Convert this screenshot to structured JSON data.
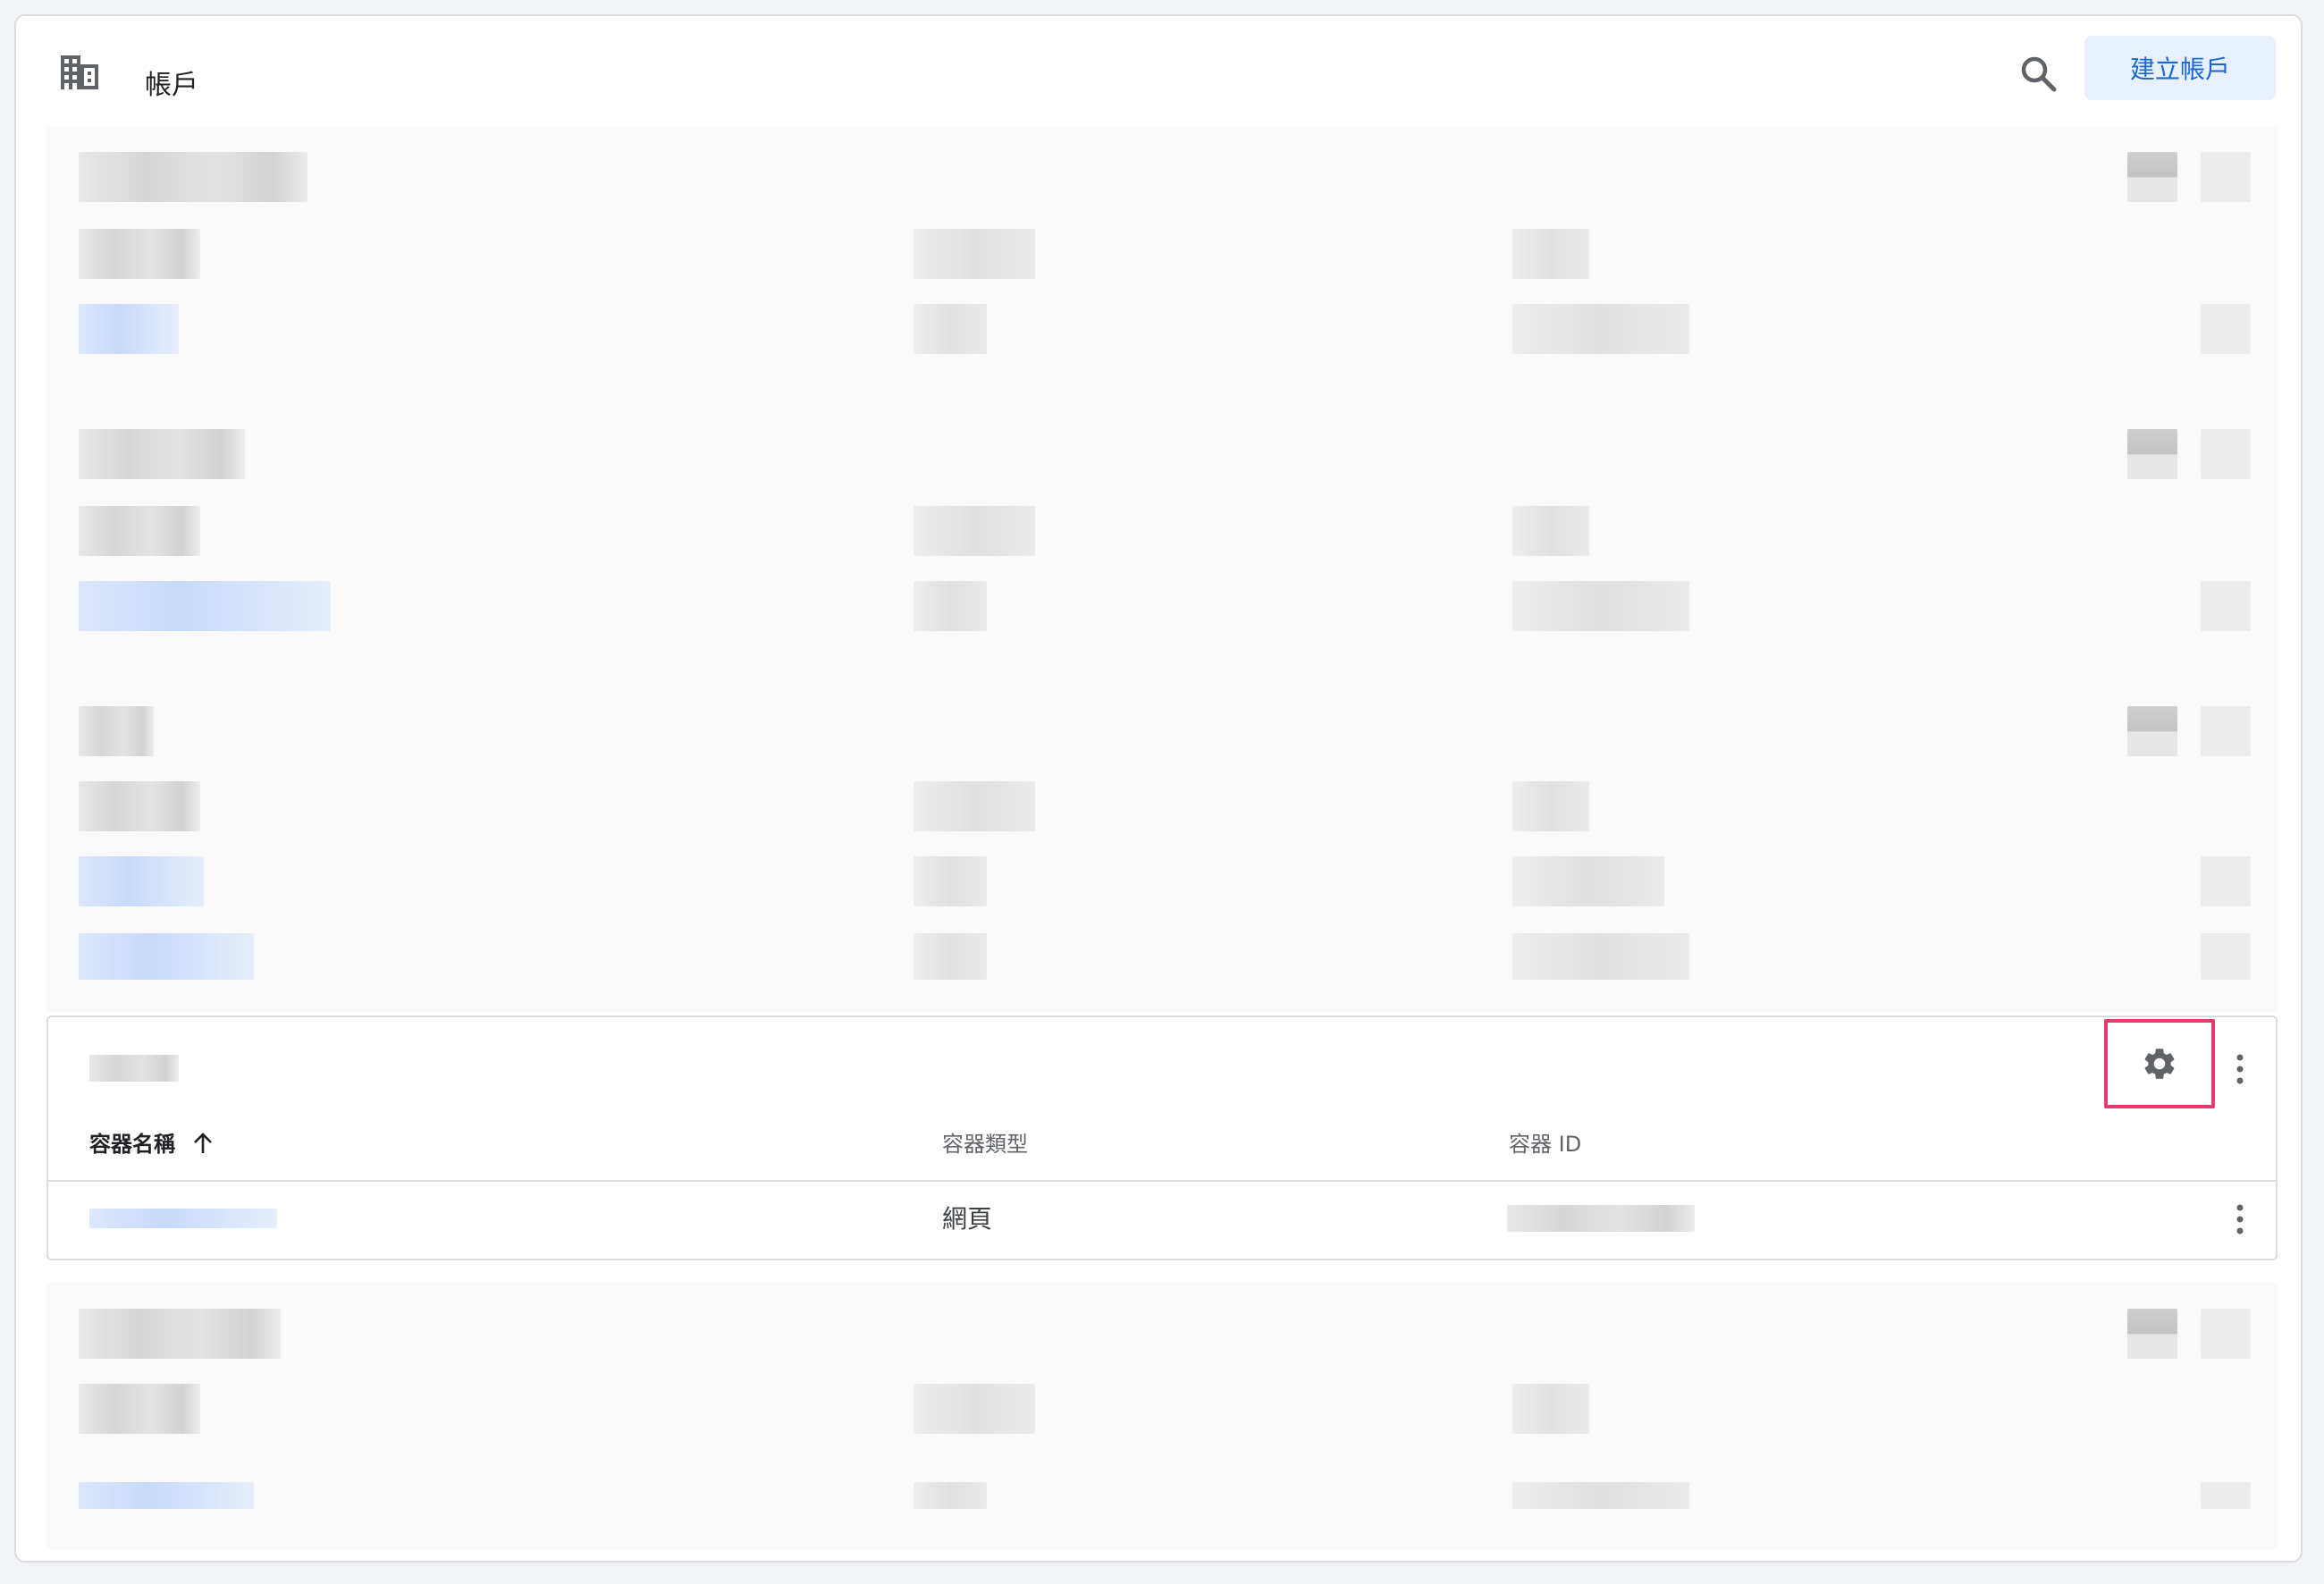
{
  "header": {
    "title": "帳戶",
    "create_button": "建立帳戶",
    "icons": {
      "left": "building-icon",
      "search": "search-icon"
    }
  },
  "account": {
    "settings_icon": "gear-icon",
    "more_icon": "more-vert-icon",
    "table": {
      "columns": [
        {
          "label": "容器名稱",
          "sorted": "ascending",
          "sort_icon": "arrow-up-icon"
        },
        {
          "label": "容器類型"
        },
        {
          "label": "容器 ID"
        }
      ],
      "rows": [
        {
          "type": "網頁",
          "more_icon": "more-vert-icon"
        }
      ]
    }
  },
  "colors": {
    "accent": "#1967d2",
    "button_bg": "#e8f0fe",
    "highlight": "#ea3a6b",
    "border": "#dadce0",
    "background": "#f1f3f4"
  }
}
